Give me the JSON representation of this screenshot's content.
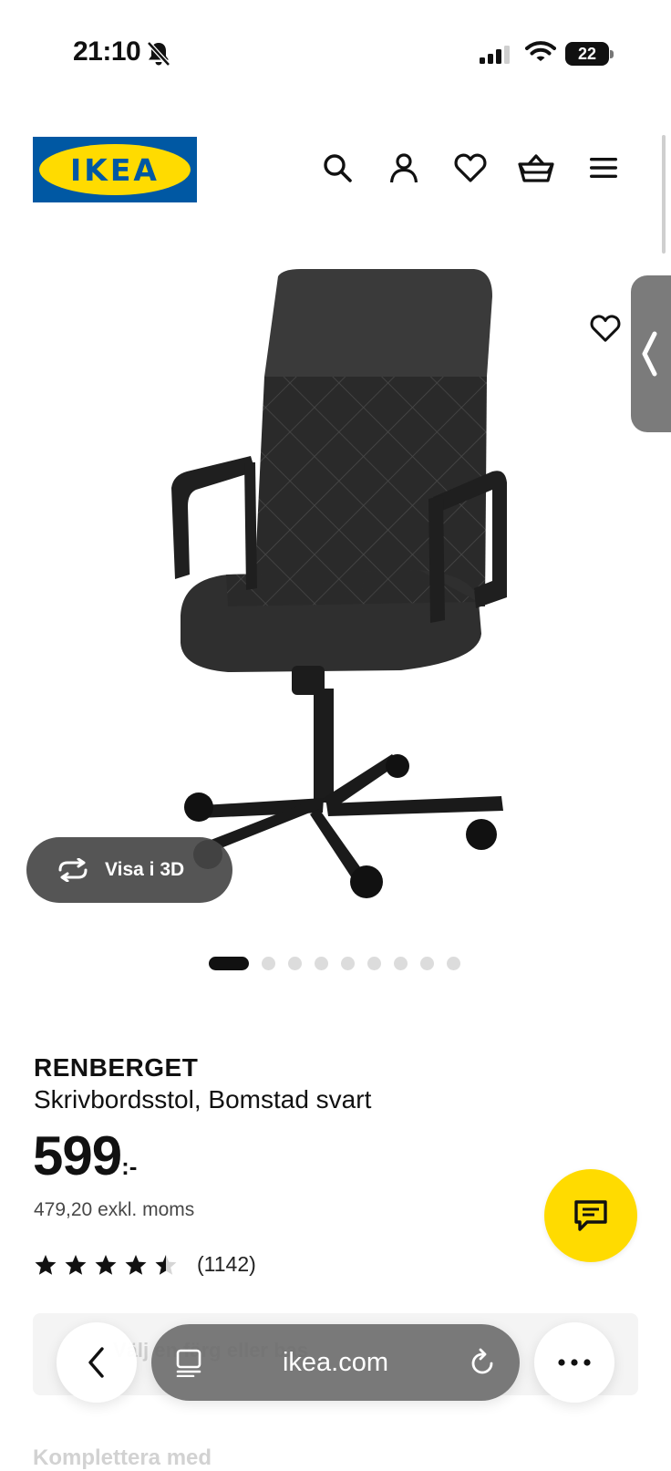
{
  "status_bar": {
    "time": "21:10",
    "battery": "22",
    "icons": [
      "bell-slash-icon",
      "signal-icon",
      "wifi-icon",
      "battery-icon"
    ]
  },
  "header": {
    "logo_text": "IKEA",
    "icons": [
      "search-icon",
      "account-icon",
      "heart-icon",
      "cart-icon",
      "menu-icon"
    ],
    "brand_colors": {
      "blue": "#0058a3",
      "yellow": "#ffdb00"
    }
  },
  "gallery": {
    "image": "office-chair",
    "favorite_icon": "heart-icon",
    "view_3d_label": "Visa i 3D",
    "total_images": 9,
    "active_image": 1
  },
  "product": {
    "name": "RENBERGET",
    "description": "Skrivbordsstol, Bomstad svart",
    "price": "599",
    "price_suffix": ":-",
    "price_excl": "479,20 exkl. moms",
    "rating": 4.5,
    "rating_count": "(1142)"
  },
  "chat": {
    "icon": "chat-icon",
    "color": "#ffdb00"
  },
  "faded_content": {
    "panel_text": "Välj en färg eller bas",
    "heading": "Komplettera med"
  },
  "browser": {
    "url": "ikea.com",
    "icons": [
      "back-icon",
      "tabs-icon",
      "reload-icon",
      "more-icon"
    ]
  }
}
